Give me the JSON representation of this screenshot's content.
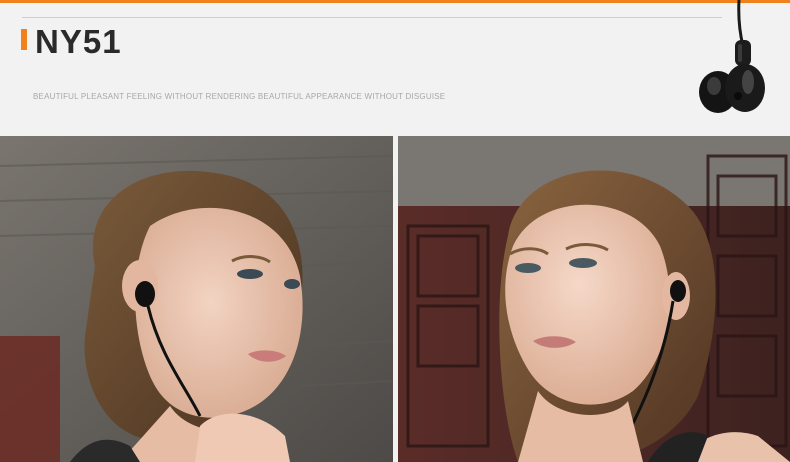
{
  "header": {
    "title": "NY51",
    "tagline": "BEAUTIFUL PLEASANT FEELING WITHOUT RENDERING BEAUTIFUL APPEARANCE WITHOUT DISGUISE"
  },
  "colors": {
    "accent": "#f0821e",
    "title": "#2a2a2a",
    "tagline": "#a8a8a8",
    "background": "#f2f2f2"
  },
  "images": [
    {
      "name": "photo-woman-wearing-earphones-left"
    },
    {
      "name": "photo-woman-wearing-earphones-right"
    }
  ]
}
